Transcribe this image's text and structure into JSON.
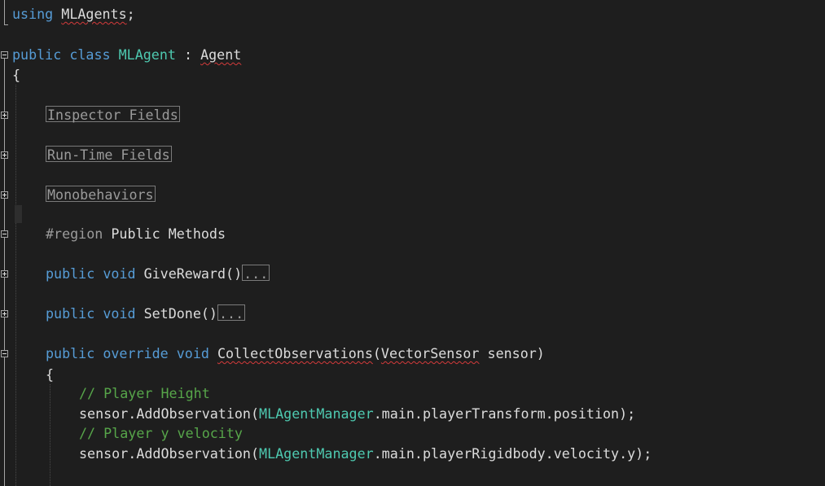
{
  "editor": {
    "line_using_top": "using MLAgents;",
    "class_decl": {
      "kw_public": "public",
      "kw_class": "class",
      "class_name": "MLAgent",
      "colon": ":",
      "base": "Agent"
    },
    "open_brace": "{",
    "collapsed_regions": [
      "Inspector Fields",
      "Run-Time Fields",
      "Monobehaviors"
    ],
    "region_line": {
      "kw": "#region",
      "name": "Public Methods"
    },
    "methods": [
      {
        "kw_public": "public",
        "kw_void": "void",
        "name": "GiveReward()",
        "collapsed": "..."
      },
      {
        "kw_public": "public",
        "kw_void": "void",
        "name": "SetDone()",
        "collapsed": "..."
      }
    ],
    "collect": {
      "kw_public": "public",
      "kw_override": "override",
      "kw_void": "void",
      "name": "CollectObservations",
      "open_paren": "(",
      "param_type": "VectorSensor",
      "param_name": " sensor)",
      "open_brace": "{",
      "comment1": "// Player Height",
      "stmt1_a": "sensor.AddObservation(",
      "stmt1_type": "MLAgentManager",
      "stmt1_b": ".main.playerTransform.position);",
      "comment2": "// Player y velocity",
      "stmt2_a": "sensor.AddObservation(",
      "stmt2_type": "MLAgentManager",
      "stmt2_b": ".main.playerRigidbody.velocity.y);"
    }
  }
}
